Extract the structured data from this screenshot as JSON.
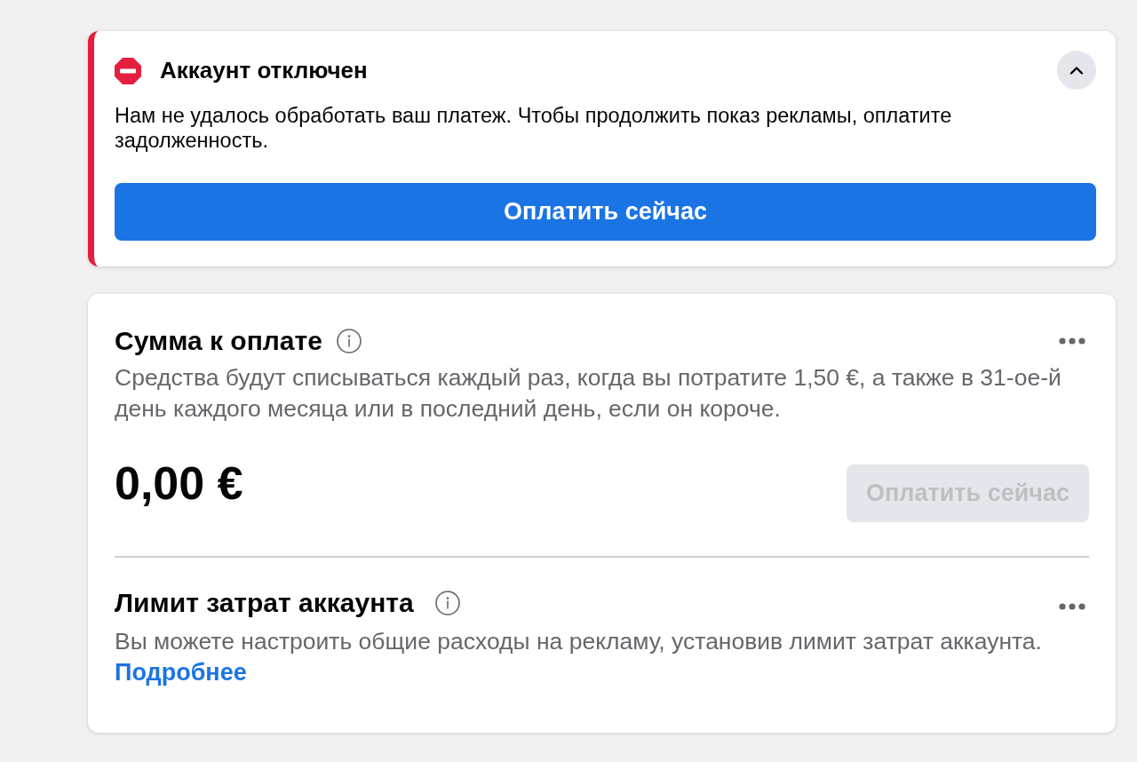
{
  "alert": {
    "title": "Аккаунт отключен",
    "expanded": true,
    "message": "Нам не удалось обработать ваш платеж. Чтобы продолжить показ рекламы, оплатите задолженность.",
    "button": "Оплатить сейчас"
  },
  "balance": {
    "title": "Сумма к оплате",
    "description": "Средства будут списываться каждый раз, когда вы потратите 1,50 €, а также в 31-ое-й день каждого месяца или в последний день, если он короче.",
    "amount": "0,00 €",
    "button": {
      "label": "Оплатить сейчас",
      "disabled": true
    }
  },
  "spending_limit": {
    "title": "Лимит затрат аккаунта",
    "description": "Вы можете настроить общие расходы на рекламу, установив лимит затрат аккаунта.",
    "link": "Подробнее"
  }
}
